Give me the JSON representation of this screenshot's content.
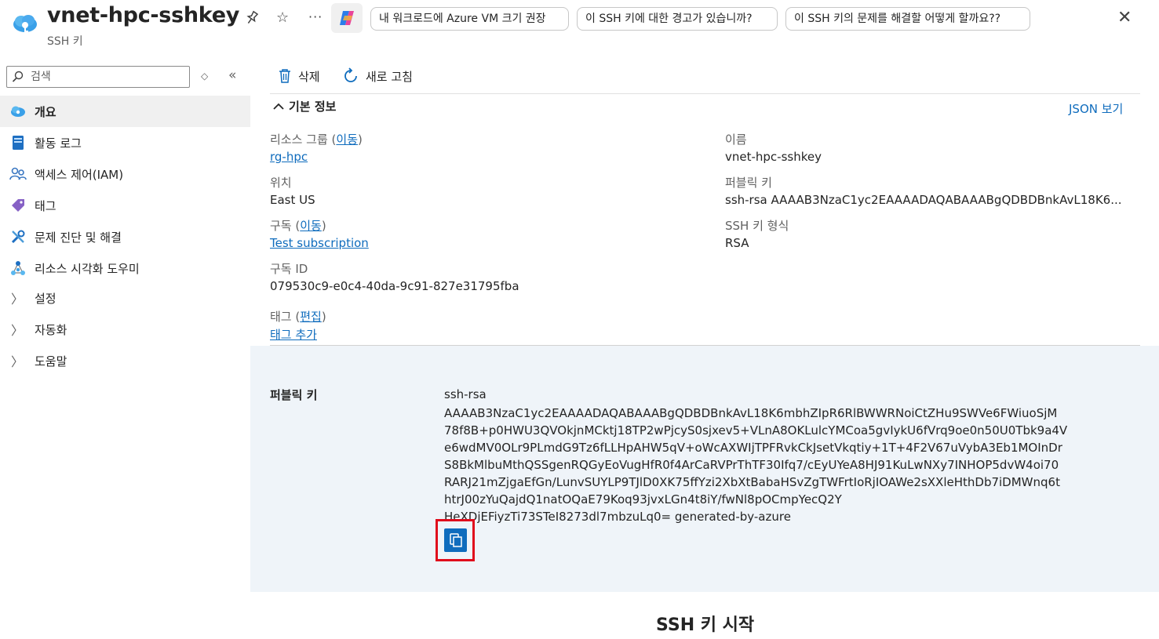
{
  "header": {
    "title": "vnet-hpc-sshkey",
    "subtitle": "SSH 키",
    "more": "···",
    "chips": [
      "내 워크로드에 Azure VM 크기 권장",
      "이 SSH 키에 대한 경고가 있습니까?",
      "이 SSH 키의 문제를 해결할 어떻게 할까요??"
    ],
    "close": "✕"
  },
  "sidebar": {
    "search_placeholder": "검색",
    "items": [
      {
        "label": "개요",
        "icon": "overview-cloud-icon",
        "active": true
      },
      {
        "label": "활동 로그",
        "icon": "activity-log-icon"
      },
      {
        "label": "액세스 제어(IAM)",
        "icon": "iam-people-icon"
      },
      {
        "label": "태그",
        "icon": "tag-icon"
      },
      {
        "label": "문제 진단 및 해결",
        "icon": "diagnose-wrench-icon"
      },
      {
        "label": "리소스 시각화 도우미",
        "icon": "resource-visualizer-icon"
      },
      {
        "label": "설정",
        "icon": "chevron-right-icon"
      },
      {
        "label": "자동화",
        "icon": "chevron-right-icon"
      },
      {
        "label": "도움말",
        "icon": "chevron-right-icon"
      }
    ]
  },
  "toolbar": {
    "delete_label": "삭제",
    "refresh_label": "새로 고침"
  },
  "essentials": {
    "section_title": "기본 정보",
    "json_view": "JSON 보기",
    "resource_group_label": "리소스 그룹",
    "resource_group_move": "이동",
    "resource_group_value": "rg-hpc",
    "location_label": "위치",
    "location_value": "East US",
    "subscription_label": "구독",
    "subscription_move": "이동",
    "subscription_value": "Test subscription",
    "subscription_id_label": "구독 ID",
    "subscription_id_value": "079530c9-e0c4-40da-9c91-827e31795fba",
    "tags_label": "태그",
    "tags_edit": "편집",
    "tags_add": "태그 추가",
    "name_label": "이름",
    "name_value": "vnet-hpc-sshkey",
    "public_key_label": "퍼블릭 키",
    "public_key_value": "ssh-rsa AAAAB3NzaC1yc2EAAAADAQABAAABgQDBDBnkAvL18K6...",
    "format_label": "SSH 키 형식",
    "format_value": "RSA"
  },
  "public_key_panel": {
    "label": "퍼블릭 키",
    "type": "ssh-rsa",
    "lines": [
      "AAAAB3NzaC1yc2EAAAADAQABAAABgQDBDBnkAvL18K6mbhZIpR6RlBWWRNoiCtZHu9SWVe6FWiuoSjM",
      "78f8B+p0HWU3QVOkjnMCktj18TP2wPjcyS0sjxev5+VLnA8OKLulcYMCoa5gvIykU6fVrq9oe0n50U0Tbk9a4V",
      "e6wdMV0OLr9PLmdG9Tz6fLLHpAHW5qV+oWcAXWIjTPFRvkCkJsetVkqtiy+1T+4F2V67uVybA3Eb1MOInDr",
      "S8BkMlbuMthQSSgenRQGyEoVugHfR0f4ArCaRVPrThTF30Ifq7/cEyUYeA8HJ91KuLwNXy7INHOP5dvW4oi70",
      "RARJ21mZjgaEfGn/LunvSUYLP9TJlD0XK75ffYzi2XbXtBabaHSvZgTWFrtIoRjIOAWe2sXXleHthDb7iDMWnq6t",
      "htrJ00zYuQajdQ1natOQaE79Koq93jvxLGn4t8iY/fwNl8pOCmpYecQ2Y",
      "HeXDjEFiyzTi73STeI8273dl7mbzuLq0= generated-by-azure"
    ]
  },
  "getting_started": "SSH 키 시작",
  "colors": {
    "accent": "#0f6cbd",
    "highlight": "#e00b1c",
    "panel_bg": "#eff4f9"
  }
}
